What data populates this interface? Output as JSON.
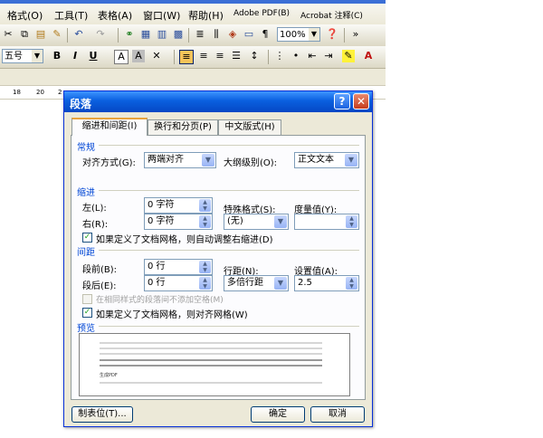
{
  "menubar": {
    "items": [
      "格式(O)",
      "工具(T)",
      "表格(A)",
      "窗口(W)",
      "帮助(H)",
      "Adobe PDF(B)",
      "Acrobat 注释(C)"
    ]
  },
  "toolbar": {
    "zoom": "100%",
    "font_size": "五号",
    "bold": "B",
    "italic": "I",
    "underline": "U",
    "font_color": "A"
  },
  "ruler": {
    "marks": [
      "18",
      "20",
      "2"
    ]
  },
  "dialog": {
    "title": "段落",
    "tabs": [
      "缩进和间距(I)",
      "换行和分页(P)",
      "中文版式(H)"
    ],
    "general": {
      "heading": "常规",
      "alignment_label": "对齐方式(G):",
      "alignment_value": "两端对齐",
      "outline_label": "大纲级别(O):",
      "outline_value": "正文文本"
    },
    "indent": {
      "heading": "缩进",
      "left_label": "左(L):",
      "left_value": "0 字符",
      "right_label": "右(R):",
      "right_value": "0 字符",
      "special_label": "特殊格式(S):",
      "special_value": "(无)",
      "by_label": "度量值(Y):",
      "by_value": "",
      "auto_adjust_label": "如果定义了文档网格，则自动调整右缩进(D)",
      "auto_adjust_checked": true
    },
    "spacing": {
      "heading": "间距",
      "before_label": "段前(B):",
      "before_value": "0 行",
      "after_label": "段后(E):",
      "after_value": "0 行",
      "line_label": "行距(N):",
      "line_value": "多倍行距",
      "at_label": "设置值(A):",
      "at_value": "2.5",
      "no_space_label": "在相同样式的段落间不添加空格(M)",
      "no_space_checked": false,
      "snap_grid_label": "如果定义了文档网格，则对齐网格(W)",
      "snap_grid_checked": true
    },
    "preview": {
      "heading": "预览",
      "sample_text": "生成PDF"
    },
    "buttons": {
      "tabs": "制表位(T)...",
      "ok": "确定",
      "cancel": "取消"
    }
  },
  "colors": {
    "title_blue": "#0a5fdf",
    "section_blue": "#0046d5",
    "dialog_bg": "#ece9d8"
  }
}
